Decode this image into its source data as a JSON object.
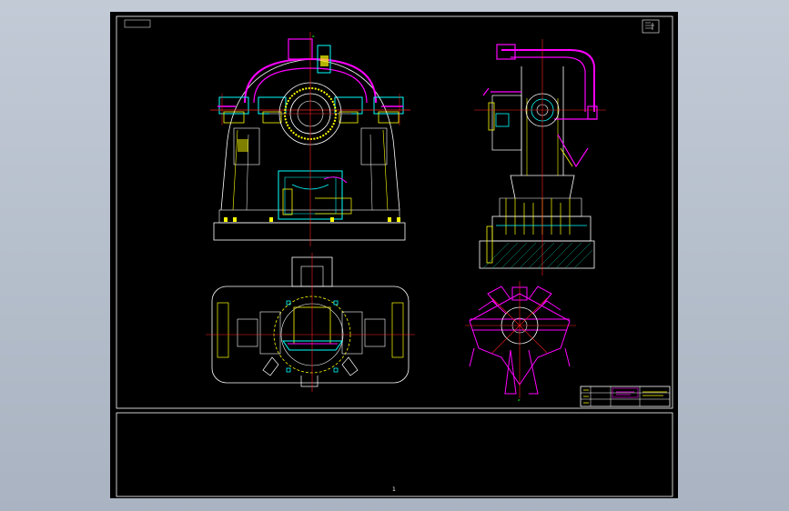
{
  "drawing": {
    "page_number": "1",
    "colors": {
      "background": "#000000",
      "frame": "#ffffff",
      "outline": "#ffffff",
      "yellow": "#ffff00",
      "magenta": "#ff00ff",
      "cyan": "#00ffff",
      "red": "#ff2020",
      "green": "#00ff00",
      "blue": "#3a4aff"
    },
    "views": [
      "front-view",
      "side-view",
      "top-view",
      "detail-view"
    ]
  }
}
